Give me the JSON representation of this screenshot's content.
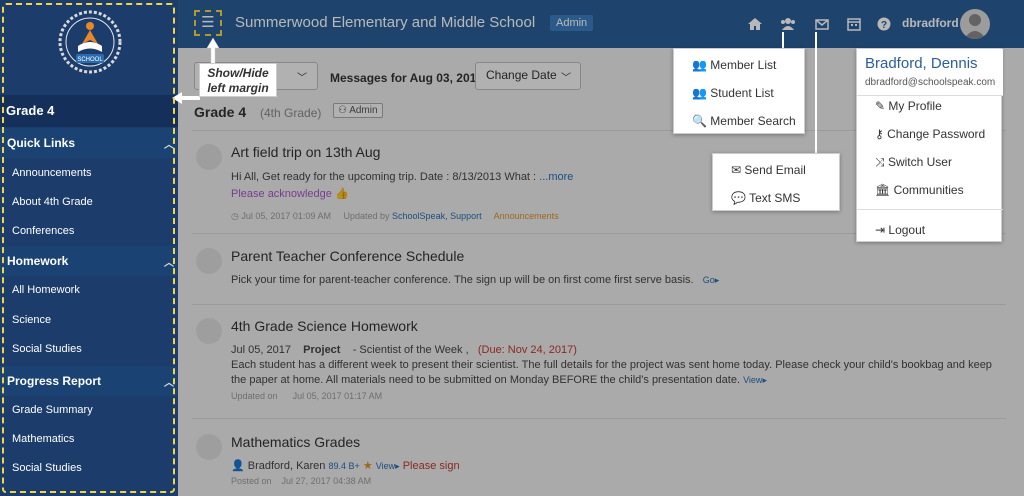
{
  "sidebar": {
    "grade_title": "Grade 4",
    "logo_text": "SCHOOL",
    "sections": [
      {
        "title": "Quick Links",
        "items": [
          "Announcements",
          "About 4th Grade",
          "Conferences"
        ]
      },
      {
        "title": "Homework",
        "items": [
          "All Homework",
          "Science",
          "Social Studies"
        ]
      },
      {
        "title": "Progress Report",
        "items": [
          "Grade Summary",
          "Mathematics",
          "Social Studies"
        ]
      }
    ]
  },
  "header": {
    "school_name": "Summerwood Elementary and Middle School",
    "admin_badge": "Admin",
    "username": "dbradford"
  },
  "callout": {
    "line1": "Show/Hide",
    "line2": "left margin"
  },
  "toolbar": {
    "dropdown_label": "",
    "messages_for": "Messages for Aug 03, 2017",
    "change_date": "Change Date"
  },
  "page": {
    "grade_heading": "Grade 4",
    "grade_sub": "(4th Grade)",
    "admin_chip": "Admin"
  },
  "items": [
    {
      "title": "Art field trip on 13th Aug",
      "body": "Hi All,   Get ready for the upcoming trip.   Date :  8/13/2013 What : ",
      "more": "...more",
      "ack": "Please acknowledge",
      "date": "Jul 05, 2017 01:09 AM",
      "updated_by_label": "Updated by",
      "updated_by": "SchoolSpeak, Support",
      "category": "Announcements"
    },
    {
      "title": "Parent Teacher Conference Schedule",
      "body": "Pick your time for parent-teacher conference. The sign up will be on first come first serve basis.",
      "go": "Go"
    },
    {
      "title": "4th Grade Science Homework",
      "date": "Jul 05, 2017",
      "type": "Project",
      "subject": "- Scientist of the Week   ,",
      "due": "(Due: Nov 24, 2017)",
      "line1": "Each student has a different week to present their scientist. The full details for the project was sent home today. Please check your child's bookbag and keep",
      "line2": "the paper at home. All materials need to be submitted on Monday BEFORE the child's presentation date.",
      "view": "View",
      "updated_on_label": "Updated on",
      "updated_on": "Jul 05, 2017 01:17 AM"
    },
    {
      "title": "Mathematics Grades",
      "person": "Bradford, Karen",
      "score": "89.4 B+",
      "view": "View",
      "sign": "Please sign",
      "posted_on_label": "Posted on",
      "posted_on": "Jul 27, 2017 04:38 AM"
    }
  ],
  "members_menu": [
    "Member List",
    "Student List",
    "Member Search"
  ],
  "contact_menu": [
    "Send Email",
    "Text SMS"
  ],
  "user_menu": {
    "name": "Bradford, Dennis",
    "email": "dbradford@schoolspeak.com",
    "items": [
      "My Profile",
      "Change Password",
      "Switch User",
      "Communities"
    ],
    "logout": "Logout"
  }
}
